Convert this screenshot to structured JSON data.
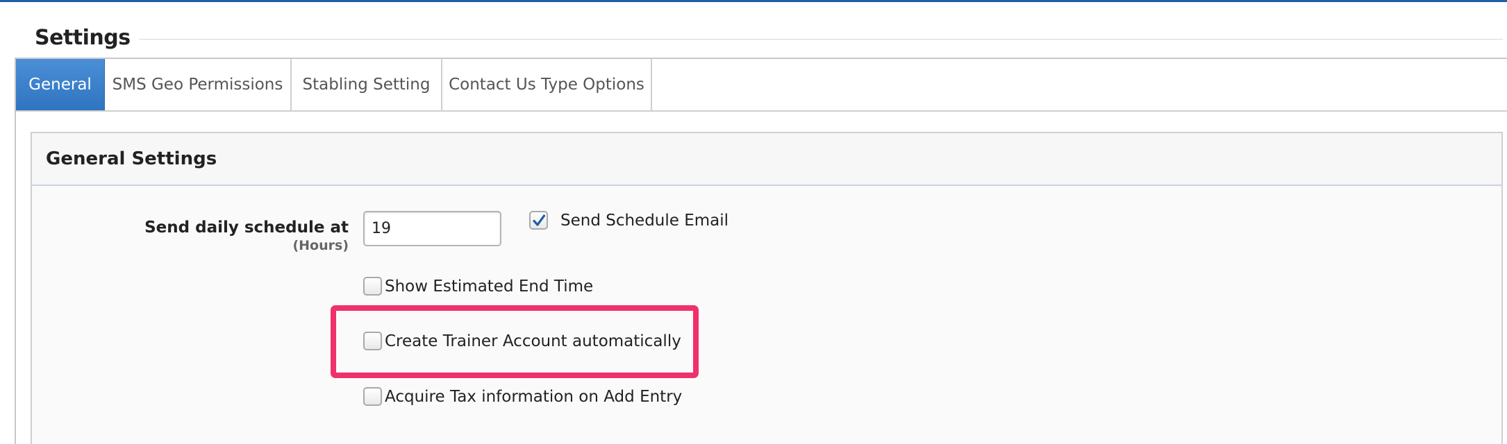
{
  "page": {
    "title": "Settings"
  },
  "tabs": [
    {
      "label": "General",
      "active": true
    },
    {
      "label": "SMS Geo Permissions",
      "active": false
    },
    {
      "label": "Stabling Setting",
      "active": false
    },
    {
      "label": "Contact Us Type Options",
      "active": false
    }
  ],
  "general_settings": {
    "header": "General Settings",
    "schedule_label": "Send daily schedule at",
    "schedule_unit": "(Hours)",
    "schedule_hours_value": "19",
    "options": {
      "send_schedule_email": {
        "label": "Send Schedule Email",
        "checked": true
      },
      "show_estimated_end_time": {
        "label": "Show Estimated End Time",
        "checked": false
      },
      "create_trainer_account": {
        "label": "Create Trainer Account automatically",
        "checked": false
      },
      "acquire_tax_information": {
        "label": "Acquire Tax information on Add Entry",
        "checked": false
      }
    }
  },
  "colors": {
    "accent_blue": "#2f74c0",
    "highlight": "#f0306a",
    "checkmark": "#1f5ea8"
  },
  "icons": {
    "checkmark": "check-icon"
  }
}
